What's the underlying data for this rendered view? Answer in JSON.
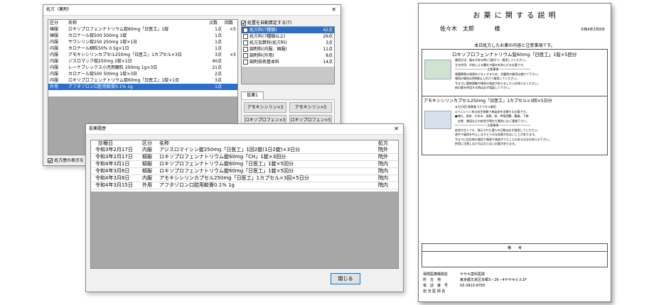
{
  "rx_window": {
    "title": "処方（薬剤）",
    "headers": [
      "区分",
      "名称",
      "点数",
      "回数"
    ],
    "rows": [
      [
        "頓服",
        "ロキソプロフェンナトリウム錠60mg「日医工」1錠",
        "1点",
        "×5"
      ],
      [
        "頓服",
        "カロナール錠500 500mg 1錠",
        "1点",
        ""
      ],
      [
        "内服",
        "サワシリン錠250 250mg 1錠×1日",
        "1点",
        ""
      ],
      [
        "内服",
        "カロナール細粒50% 0.5g×1日",
        "1点",
        ""
      ],
      [
        "内服",
        "アモキシシリンカプセル250mg「日医工」1カプセル×3日",
        "3点",
        "×5"
      ],
      [
        "内服",
        "ジスロマック錠250mg 2錠×1日",
        "40点",
        ""
      ],
      [
        "内服",
        "レーケブレックス小児用顆粒 200mg 1g×3日",
        "21点",
        ""
      ],
      [
        "内服",
        "カロナール錠500 500mg 1錠×3日",
        "2点",
        ""
      ],
      [
        "内服",
        "ロキソプロフェンナトリウム錠60mg「日医工」1錠×1日",
        "3点",
        ""
      ],
      [
        "外用",
        "アフタゾロン口腔用軟膏0.1% 1g",
        "1点",
        ""
      ]
    ],
    "auto_calc_label": "処置を自動算定する(T)",
    "options": [
      {
        "label": "処方料(7種類)",
        "value": "42点",
        "selected": true
      },
      {
        "label": "処方料(7種類以上)",
        "value": "29点",
        "selected": false
      },
      {
        "label": "処方加算料(処方料)",
        "value": "3点",
        "selected": false
      },
      {
        "label": "調剤料(内服、頓服)",
        "value": "11点",
        "selected": false
      },
      {
        "label": "調剤料(外用)",
        "value": "8点",
        "selected": false
      },
      {
        "label": "調剤技術基本料",
        "value": "14点",
        "selected": false
      }
    ],
    "frequent_label": "投薬1",
    "quick_buttons": [
      "アモキシシリン×3",
      "アモキシリン×5",
      "ロキソプロフェン×3",
      "ロキソプロフェン×5"
    ],
    "bottom_checkbox": "処方歴の表示を"
  },
  "history_window": {
    "title": "投薬履歴",
    "headers": [
      "診療日",
      "区分",
      "名称",
      "処方"
    ],
    "rows": [
      [
        "令和3年2月17日",
        "内服",
        "アジスロマイシン錠250mg「日医工」1回2錠(1日2錠)×3日分",
        "院外"
      ],
      [
        "令和3年2月17日",
        "頓服",
        "ロキソプロフェンナトリウム錠60mg「CH」1錠×3回分",
        "院外"
      ],
      [
        "令和4年3月1日",
        "頓服",
        "ロキソプロフェンナトリウム錠60mg「日医工」1錠×5回分",
        "院内"
      ],
      [
        "令和4年3月8日",
        "頓服",
        "ロキソプロフェンナトリウム錠60mg「日医工」1錠×5回分",
        "院内"
      ],
      [
        "令和4年3月8日",
        "内服",
        "アモキシシリンカプセル250mg「日医工」1カプセル×3回×5日分",
        "院内"
      ],
      [
        "令和4年3月15日",
        "外用",
        "アフタゾロン口腔用軟膏0.1% 1g",
        "院内"
      ]
    ],
    "close_label": "閉じる"
  },
  "leaflet": {
    "title": "お 薬 に 関 す る 説 明",
    "patient": "佐々木　太郎",
    "honorific": "様",
    "date": "令和4年3月8日",
    "intro": "本日処方したお薬の内容と注意事項です。",
    "drugs": [
      {
        "name": "ロキソプロフェンナトリウム錠60mg「日医工」1錠×5回分",
        "lines": [
          "服用方法：痛みがある時に1錠ずつ、服用してください。",
          "主な作用：炎症による腫れや痛みを和らげるお薬です。",
          "――――――――――― 注意事項 ―――――――――――",
          "胃腸障害の発現を少なくするため、空腹時の服用は避けて下さい。",
          "頓用の場合は6時間以上空けて服用してください。",
          "今までに薬剤過敏や喘息の発症がありましたらお知らせください。",
          "他の薬を併用する時は必ず相談して下さい。"
        ]
      },
      {
        "name": "アモキシシリンカプセル250mg「日医工」1カプセル×3回×5日分",
        "lines": [
          "★1日3回 毎食後 1カプセル服用",
          "◎ペニシリン系の抗生物質で感染症を治療するお薬です。",
          "●嘔吐、発疹、かゆみ、発熱、咳、呼吸困難、腹痛、下痢",
          "　自覚、普段などの症状が現れた場合にはご連絡下さい。",
          "――――――――――― 注意事項 ―――――――――――",
          "症状がなくても、指示された通りの日数は必ず服用してください。",
          "途中で服用を中止しますと十分な効果が出ないことがあります。",
          "今までに抗生剤の服用で喘息や発疹がでたことのある方はお知らせ下さい。",
          "併用に注意しなければならないお薬があります。"
        ]
      }
    ],
    "remarks_label": "備　　考",
    "footer": [
      {
        "label": "保険医療機関名",
        "value": "ササキ歯科医院"
      },
      {
        "label": "所　在　地",
        "value": "東京都文京区本郷3－26－4ササキビル1F"
      },
      {
        "label": "電　話　番　号",
        "value": "03-3810-8765"
      },
      {
        "label": "担 当 医 師 名",
        "value": ""
      }
    ]
  }
}
